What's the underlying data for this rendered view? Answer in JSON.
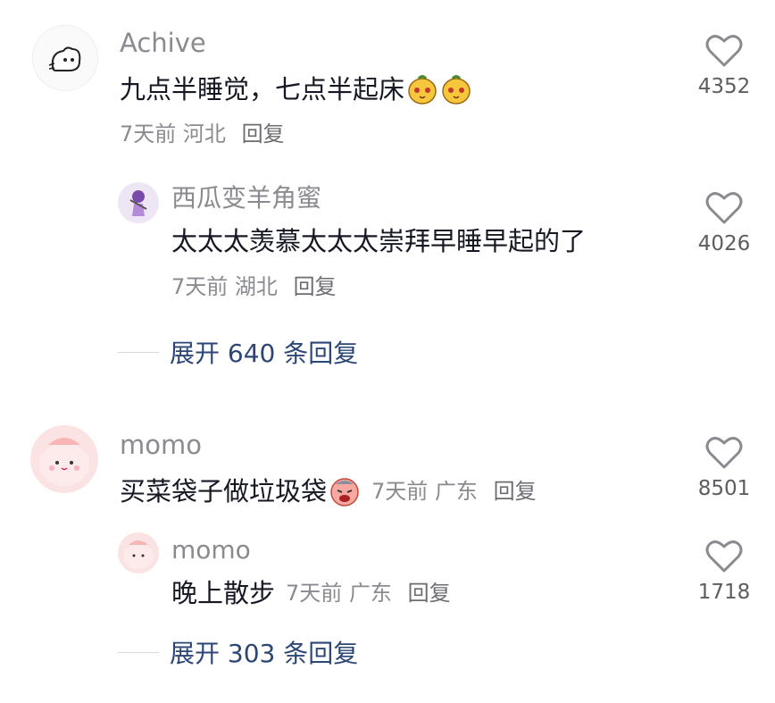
{
  "comments": [
    {
      "username": "Achive",
      "text": "九点半睡觉，七点半起床",
      "emojis": [
        "mango-face-emoji",
        "mango-face-emoji"
      ],
      "time": "7天前",
      "location": "河北",
      "reply_label": "回复",
      "likes": "4352",
      "replies": [
        {
          "username": "西瓜变羊角蜜",
          "text": "太太太羡慕太太太崇拜早睡早起的了",
          "time": "7天前",
          "location": "湖北",
          "reply_label": "回复",
          "likes": "4026"
        }
      ],
      "expand_label": "展开 640 条回复"
    },
    {
      "username": "momo",
      "text": "买菜袋子做垃圾袋",
      "emojis": [
        "crying-face-emoji"
      ],
      "time": "7天前",
      "location": "广东",
      "reply_label": "回复",
      "likes": "8501",
      "replies": [
        {
          "username": "momo",
          "text": "晚上散步",
          "time": "7天前",
          "location": "广东",
          "reply_label": "回复",
          "likes": "1718"
        }
      ],
      "expand_label": "展开 303 条回复"
    }
  ],
  "colors": {
    "username": "#8a8b91",
    "text": "#161823",
    "expand": "#2c4777",
    "heart": "#8a8b91"
  }
}
